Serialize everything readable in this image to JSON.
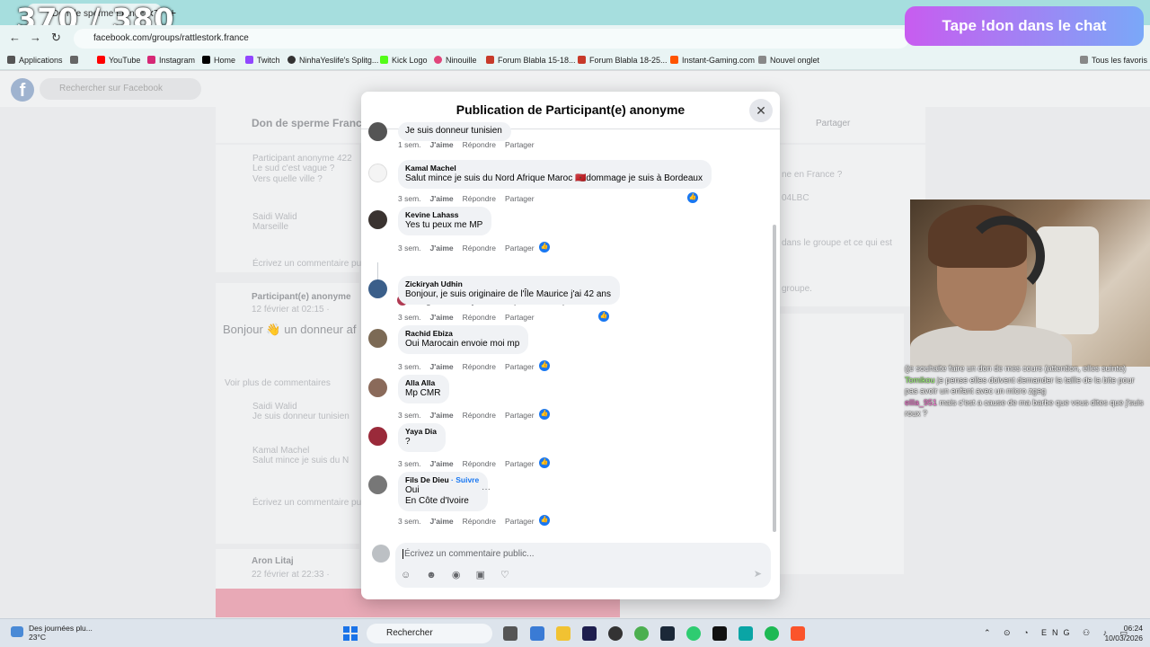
{
  "browser": {
    "stream_counter": "370 / 380",
    "tab_title": "Don de sperme France – Tro",
    "url": "facebook.com/groups/rattlestork.france",
    "bookmarks": [
      {
        "label": "Applications",
        "color": "#444"
      },
      {
        "label": "",
        "color": "#666"
      },
      {
        "label": "YouTube",
        "color": "#ff0000"
      },
      {
        "label": "Instagram",
        "color": "#d62976"
      },
      {
        "label": "Home",
        "color": "#000"
      },
      {
        "label": "Twitch",
        "color": "#9146ff"
      },
      {
        "label": "NinhaYeslife's Splitg...",
        "color": "#333"
      },
      {
        "label": "Kick Logo",
        "color": "#53fc18"
      },
      {
        "label": "Ninouille",
        "color": "#e0457b"
      },
      {
        "label": "Forum Blabla 15-18...",
        "color": "#c73a2a"
      },
      {
        "label": "Forum Blabla 18-25...",
        "color": "#c73a2a"
      },
      {
        "label": "Instant-Gaming.com",
        "color": "#ff5400"
      },
      {
        "label": "Nouvel onglet",
        "color": "#666"
      }
    ],
    "all_favorites": "Tous les favoris"
  },
  "overlay": {
    "banner": "Tape !don dans le chat",
    "chat": [
      {
        "user": "",
        "text": "(je souhaite faire un don de mes cours (attention, elles suinte)"
      },
      {
        "user": "Tomikou",
        "text": "je pense elles doivent demander la taille de la bite pour pas avoir un enfant avec un micro zgeg"
      },
      {
        "user": "ellla_951",
        "text": "mais c'est a cause de ma barbe que vous dites que j'suis roux ?"
      }
    ]
  },
  "facebook_bg": {
    "search_placeholder": "Rechercher sur Facebook",
    "group_name": "Don de sperme France -",
    "share": "Partager",
    "bg_post_author": "Participant(e) anonyme",
    "bg_post_date": "12 février at 02:15 ·",
    "bg_post_text": "Bonjour 👋 un donneur af",
    "bg_view_more": "Voir plus de commentaires",
    "bg_aron": "Aron Litaj",
    "bg_aron_date": "22 février at 22:33 ·",
    "bg_right1": "ne en France ?",
    "bg_right2": "04LBC",
    "bg_right3": "dans le groupe et ce qui est",
    "bg_right4": "groupe.",
    "bg_left_comments": [
      {
        "name": "Participant anonyme 422",
        "text": "Le sud c'est vague ?"
      },
      {
        "name": "",
        "text": "Vers quelle ville ?"
      },
      {
        "name": "Saidi Walid",
        "text": "Marseille"
      },
      {
        "name": "Saidi Walid",
        "text": "Je suis donneur tunisien"
      },
      {
        "name": "Kamal Machel",
        "text": "Salut mince je suis du N"
      }
    ],
    "bg_write": "Écrivez un commentaire pu",
    "bg_actions": "3 sem.   J'aime   Répondre   Partager"
  },
  "modal": {
    "title": "Publication de Participant(e) anonyme",
    "close_icon": "close-icon",
    "action_like": "J'aime",
    "action_reply": "Répondre",
    "action_share": "Partager",
    "comments": [
      {
        "author": "",
        "text": "Je suis donneur tunisien",
        "time": "1 sem.",
        "liked": false
      },
      {
        "author": "Kamal Machel",
        "text": "Salut mince je suis du Nord Afrique Maroc 🇲🇦dommage je suis à Bordeaux",
        "time": "3 sem.",
        "liked": true
      },
      {
        "author": "Kevine Lahass",
        "text": "Yes tu peux me MP",
        "time": "3 sem.",
        "liked": true
      },
      {
        "author": "Zickiryah Udhin",
        "text": "Bonjour, je suis originaire de l'Île Maurice j'ai 42 ans",
        "time": "3 sem.",
        "liked": true
      },
      {
        "author": "Rachid Ebiza",
        "text": "Oui Marocain envoie moi mp",
        "time": "3 sem.",
        "liked": true
      },
      {
        "author": "Alla Alla",
        "text": "Mp CMR",
        "time": "3 sem.",
        "liked": true
      },
      {
        "author": "Yaya Dia",
        "text": "?",
        "time": "3 sem.",
        "liked": true
      },
      {
        "author": "Fils De Dieu",
        "follow": "· Suivre",
        "text": "Oui",
        "text2": "En Côte d'Ivoire",
        "time": "3 sem.",
        "liked": true
      }
    ],
    "reply_summary": "IndigoCranberry3253 a répondu · 1 réponses",
    "more_options": "···",
    "composer_placeholder": "Écrivez un commentaire public...",
    "composer_icons": "☺ ☻ ◉ ▣ ♡"
  },
  "taskbar": {
    "weather_text": "Des journées plu...",
    "weather_temp": "23°C",
    "search": "Rechercher",
    "lang": "ENG",
    "time": "06:24",
    "date": "10/03/2026"
  }
}
